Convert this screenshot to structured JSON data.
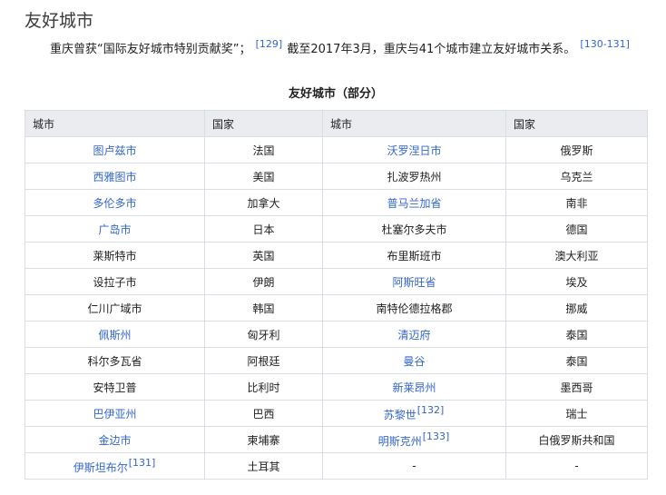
{
  "heading": "友好城市",
  "intro": {
    "text_before": "重庆曾获“国际友好城市特别贡献奖”；",
    "ref1": "[129]",
    "text_after": "截至2017年3月，重庆与41个城市建立友好城市关系。",
    "ref2": "[130-131]"
  },
  "caption": "友好城市（部分）",
  "table": {
    "headers": [
      "城市",
      "国家",
      "城市",
      "国家"
    ],
    "rows": [
      {
        "city1": "图卢兹市",
        "city1_link": true,
        "ref1": "",
        "country1": "法国",
        "city2": "沃罗涅日市",
        "city2_link": true,
        "ref2": "",
        "country2": "俄罗斯"
      },
      {
        "city1": "西雅图市",
        "city1_link": true,
        "ref1": "",
        "country1": "美国",
        "city2": "扎波罗热州",
        "city2_link": false,
        "ref2": "",
        "country2": "乌克兰"
      },
      {
        "city1": "多伦多市",
        "city1_link": true,
        "ref1": "",
        "country1": "加拿大",
        "city2": "普马兰加省",
        "city2_link": true,
        "ref2": "",
        "country2": "南非"
      },
      {
        "city1": "广岛市",
        "city1_link": true,
        "ref1": "",
        "country1": "日本",
        "city2": "杜塞尔多夫市",
        "city2_link": false,
        "ref2": "",
        "country2": "德国"
      },
      {
        "city1": "莱斯特市",
        "city1_link": false,
        "ref1": "",
        "country1": "英国",
        "city2": "布里斯班市",
        "city2_link": false,
        "ref2": "",
        "country2": "澳大利亚"
      },
      {
        "city1": "设拉子市",
        "city1_link": false,
        "ref1": "",
        "country1": "伊朗",
        "city2": "阿斯旺省",
        "city2_link": true,
        "ref2": "",
        "country2": "埃及"
      },
      {
        "city1": "仁川广域市",
        "city1_link": false,
        "ref1": "",
        "country1": "韩国",
        "city2": "南特伦德拉格郡",
        "city2_link": false,
        "ref2": "",
        "country2": "挪威"
      },
      {
        "city1": "佩斯州",
        "city1_link": true,
        "ref1": "",
        "country1": "匈牙利",
        "city2": "清迈府",
        "city2_link": true,
        "ref2": "",
        "country2": "泰国"
      },
      {
        "city1": "科尔多瓦省",
        "city1_link": false,
        "ref1": "",
        "country1": "阿根廷",
        "city2": "曼谷",
        "city2_link": true,
        "ref2": "",
        "country2": "泰国"
      },
      {
        "city1": "安特卫普",
        "city1_link": false,
        "ref1": "",
        "country1": "比利时",
        "city2": "新莱昂州",
        "city2_link": true,
        "ref2": "",
        "country2": "墨西哥"
      },
      {
        "city1": "巴伊亚州",
        "city1_link": true,
        "ref1": "",
        "country1": "巴西",
        "city2": "苏黎世",
        "city2_link": true,
        "ref2": "[132]",
        "country2": "瑞士"
      },
      {
        "city1": "金边市",
        "city1_link": true,
        "ref1": "",
        "country1": "柬埔寨",
        "city2": "明斯克州",
        "city2_link": true,
        "ref2": "[133]",
        "country2": "白俄罗斯共和国"
      },
      {
        "city1": "伊斯坦布尔",
        "city1_link": true,
        "ref1": "[131]",
        "country1": "土耳其",
        "city2": "-",
        "city2_link": false,
        "ref2": "",
        "country2": "-"
      }
    ]
  },
  "colors": {
    "link": "#3366cc",
    "header_bg": "#eaecf0",
    "border": "#dadde3"
  }
}
